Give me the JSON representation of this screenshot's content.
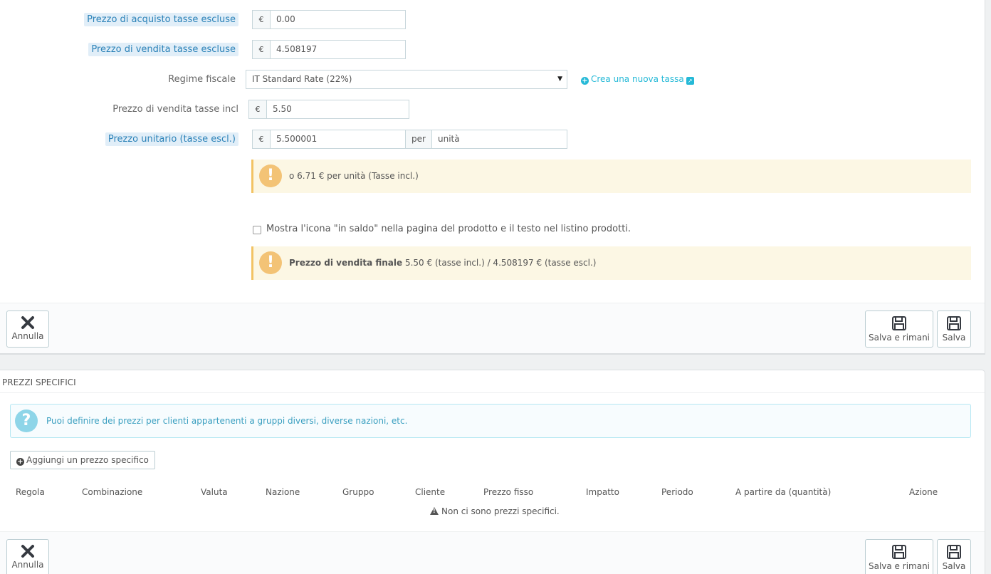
{
  "form": {
    "wholesale_label": "Prezzo di acquisto tasse escluse",
    "wholesale_currency": "€",
    "wholesale_value": "0.00",
    "price_label": "Prezzo di vendita tasse escluse",
    "price_currency": "€",
    "price_value": "4.508197",
    "tax_label": "Regime fiscale",
    "tax_value": "IT Standard Rate (22%)",
    "new_tax_link": "Crea una nuova tassa",
    "price_incl_label": "Prezzo di vendita tasse incl",
    "price_incl_currency": "€",
    "price_incl_value": "5.50",
    "unit_label": "Prezzo unitario (tasse escl.)",
    "unit_currency": "€",
    "unit_value": "5.500001",
    "unit_per": "per",
    "unit_name": "unità",
    "unit_alert": "o 6.71 € per unità (Tasse incl.)",
    "on_sale_label": "Mostra l'icona \"in saldo\" nella pagina del prodotto e il testo nel listino prodotti.",
    "final_price_bold": "Prezzo di vendita finale",
    "final_price_text": "5.50 € (tasse incl.) / 4.508197 € (tasse escl.)"
  },
  "footer1": {
    "cancel_label": "Annulla",
    "save_stay_label": "Salva e rimani",
    "save_label": "Salva"
  },
  "specific": {
    "title": "PREZZI SPECIFICI",
    "info": "Puoi definire dei prezzi per clienti appartenenti a gruppi diversi, diverse nazioni, etc.",
    "add_button": "Aggiungi un prezzo specifico",
    "columns": [
      "Regola",
      "Combinazione",
      "Valuta",
      "Nazione",
      "Gruppo",
      "Cliente",
      "Prezzo fisso",
      "Impatto",
      "Periodo",
      "A partire da (quantità)",
      "Azione"
    ],
    "empty": "Non ci sono prezzi specifici."
  },
  "footer2": {
    "cancel_label": "Annulla",
    "save_stay_label": "Salva e rimani",
    "save_label": "Salva"
  },
  "colors": {
    "accent": "#25b9d7",
    "warning_bg": "#fcf7e4",
    "warning_icon": "#f3c376",
    "info_icon": "#8ed5e8"
  }
}
